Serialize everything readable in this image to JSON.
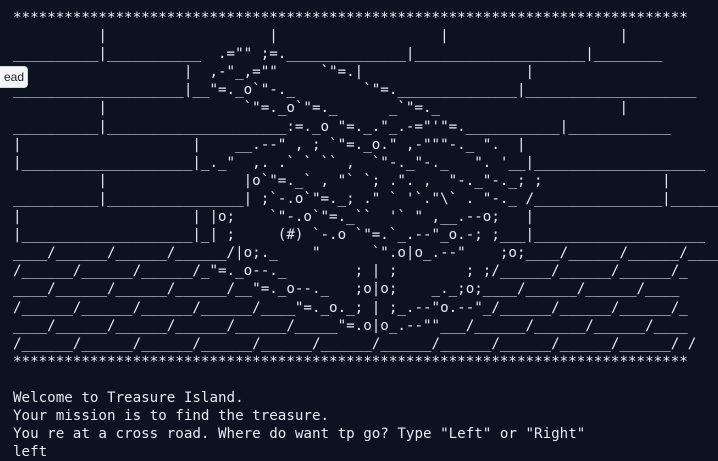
{
  "side_tab": {
    "label": "ead"
  },
  "banner": {
    "stars_top": "*******************************************************************************",
    "stars_bottom": "*******************************************************************************",
    "art": [
      "          |                   |                   |                    |",
      "__________|___________  .=\"\" ;=.______________|____________________|________",
      "                    |  ,-\"_,=\"\"     `\"=.|                   |",
      "____________________|__\"=._o`\"-._        `\"=.______________|____________________",
      "          |                `\"=._o`\"=._      _`\"=._                     |",
      "__________|_____________________:=._o \"=._.\"_.-=\"'\"=.___________|____________",
      "|                    |    __.--\" , ; `\"=._o.\" ,-\"\"\"-._ \".  |",
      "|____________________|_._\"  ,. .` ` `` ,  `\"-._\"-._   \". '__|____________________",
      "          |                |o`\"=._` , \"` `; .\". ,  \"-._\"-._; ;              |",
      "__________|________________| ;`-.o`\"=._; .\" ` '`.\"\\` . \"-._ /_______________|______",
      "|                    | |o;    `\"-.o`\"=._``  '` \" ,__.--o;   |",
      "|____________________|_| ;     (#) `-.o `\"=.`_.--\"_o.-; ;___|____________________",
      "____/______/______/______/|o;._    \"      `\".o|o_.--\"    ;o;____/______/______/____",
      "/______/______/______/_\"=._o--._        ; | ;        ; ;/______/______/______/_",
      "____/______/______/______/__\"=._o--._   ;o|o;    _._;o;____/______/______/____",
      "/______/______/______/______/____\"=._o._; | ;_.--\"o.--\"_/______/______/______/_",
      "____/______/______/______/______/_____\"=.o|o_.--\"\"___/______/______/______/____",
      "/______/______/______/______/______/______/______/______/______/______/______/ /"
    ]
  },
  "messages": [
    "Welcome to Treasure Island.",
    "Your mission is to find the treasure.",
    "You re at a cross road. Where do want tp go? Type \"Left\" or \"Right\"",
    "left"
  ]
}
